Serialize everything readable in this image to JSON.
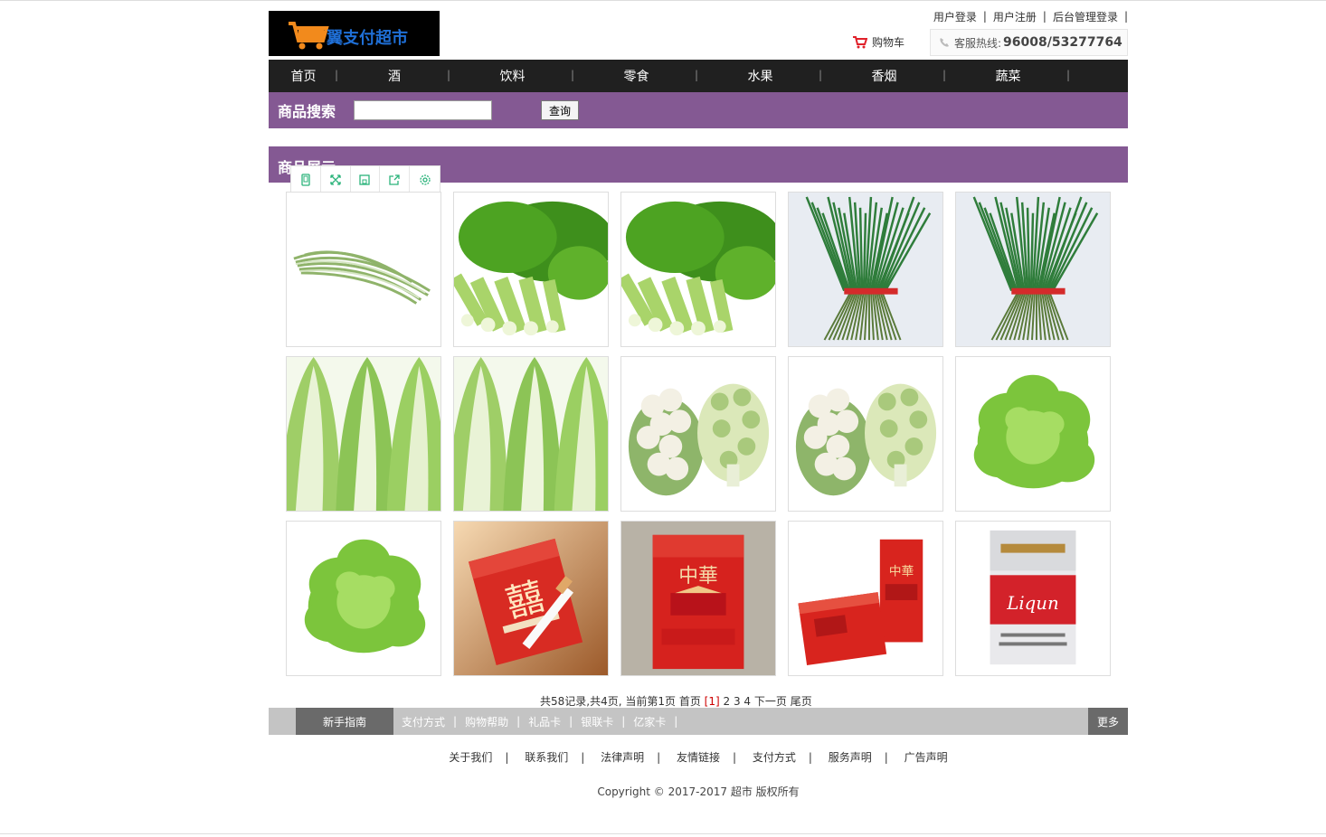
{
  "logo": {
    "text": "翼支付超市"
  },
  "top_links": [
    "用户登录",
    "用户注册",
    "后台管理登录"
  ],
  "cart_label": "购物车",
  "hotline": {
    "label": "客服热线:",
    "number": "96008/53277764"
  },
  "nav": [
    "首页",
    "酒",
    "饮料",
    "零食",
    "水果",
    "香烟",
    "蔬菜"
  ],
  "search": {
    "title": "商品搜索",
    "value": "",
    "button": "查询"
  },
  "showcase": {
    "title": "商品展示"
  },
  "toolbar_icons": [
    "phone-icon",
    "expand-icon",
    "save-icon",
    "share-icon",
    "settings-icon"
  ],
  "products": [
    {
      "kind": "leek"
    },
    {
      "kind": "celery"
    },
    {
      "kind": "celery"
    },
    {
      "kind": "chives"
    },
    {
      "kind": "chives"
    },
    {
      "kind": "cabbage"
    },
    {
      "kind": "cabbage"
    },
    {
      "kind": "cauliflower"
    },
    {
      "kind": "cauliflower"
    },
    {
      "kind": "lettuce"
    },
    {
      "kind": "lettuce"
    },
    {
      "kind": "cig-double-happiness"
    },
    {
      "kind": "cig-zhonghua-box"
    },
    {
      "kind": "cig-zhonghua-pack"
    },
    {
      "kind": "cig-liqun"
    }
  ],
  "pager": {
    "summary": "共58记录,共4页, 当前第1页",
    "first": "首页",
    "current": "[1]",
    "pages": [
      "2",
      "3",
      "4"
    ],
    "next": "下一页",
    "last": "尾页"
  },
  "help": {
    "first": "新手指南",
    "links": [
      "支付方式",
      "购物帮助",
      "礼品卡",
      "银联卡",
      "亿家卡"
    ],
    "more": "更多"
  },
  "footer_links": [
    "关于我们",
    "联系我们",
    "法律声明",
    "友情链接",
    "支付方式",
    "服务声明",
    "广告声明"
  ],
  "copyright": "Copyright © 2017-2017 超市 版权所有",
  "colors": {
    "accent": "#845993",
    "nav_bg": "#202020",
    "help_bg": "#c4c4c4",
    "help_dark": "#6a6a6a",
    "price_red": "#cc0000"
  }
}
